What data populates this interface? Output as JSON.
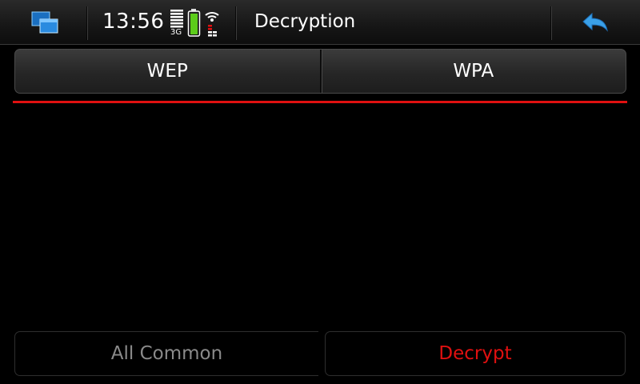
{
  "statusbar": {
    "time": "13:56",
    "network_type": "3G",
    "title": "Decryption",
    "icons": {
      "switcher": "task-switcher-icon",
      "signal": "signal-strength-icon",
      "battery": "battery-icon",
      "wifi": "wifi-icon",
      "back": "back-arrow-icon"
    }
  },
  "tabs": [
    {
      "label": "WEP"
    },
    {
      "label": "WPA"
    }
  ],
  "actions": {
    "all_common_label": "All Common",
    "decrypt_label": "Decrypt"
  },
  "colors": {
    "accent_red": "#e01010",
    "back_arrow_blue": "#3aa0e8",
    "battery_green": "#5ccc1a"
  }
}
